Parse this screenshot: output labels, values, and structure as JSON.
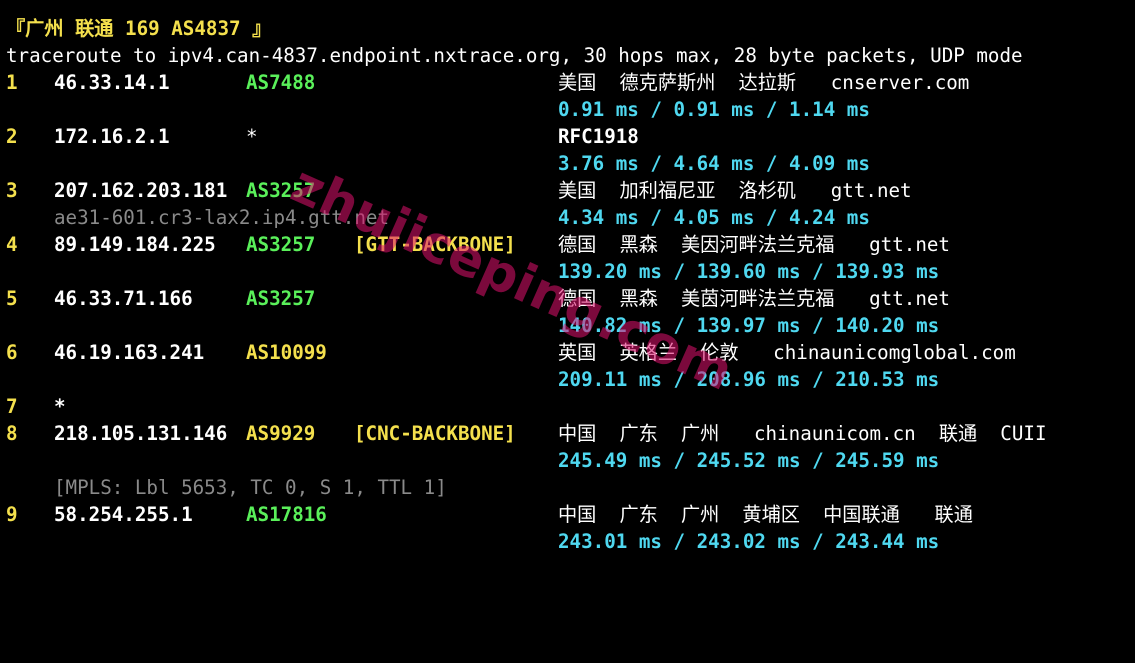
{
  "header": "『广州 联通 169 AS4837 』",
  "trace_cmd": "traceroute to ipv4.can-4837.endpoint.nxtrace.org, 30 hops max, 28 byte packets, UDP mode",
  "hops": [
    {
      "n": "1",
      "ip": "46.33.14.1",
      "asn": "AS7488",
      "tag": "",
      "geo": "美国  德克萨斯州  达拉斯   cnserver.com",
      "rtt": "0.91 ms / 0.91 ms / 1.14 ms"
    },
    {
      "n": "2",
      "ip": "172.16.2.1",
      "asn": "*",
      "tag": "",
      "geo": "RFC1918",
      "rtt": "3.76 ms / 4.64 ms / 4.09 ms"
    },
    {
      "n": "3",
      "ip": "207.162.203.181",
      "asn": "AS3257",
      "tag": "",
      "geo": "美国  加利福尼亚  洛杉矶   gtt.net",
      "rtt": "4.34 ms / 4.05 ms / 4.24 ms",
      "rdns": "ae31-601.cr3-lax2.ip4.gtt.net"
    },
    {
      "n": "4",
      "ip": "89.149.184.225",
      "asn": "AS3257",
      "tag": "[GTT-BACKBONE]",
      "geo": "德国  黑森  美因河畔法兰克福   gtt.net",
      "rtt": "139.20 ms / 139.60 ms / 139.93 ms"
    },
    {
      "n": "5",
      "ip": "46.33.71.166",
      "asn": "AS3257",
      "tag": "",
      "geo": "德国  黑森  美茵河畔法兰克福   gtt.net",
      "rtt": "140.82 ms / 139.97 ms / 140.20 ms"
    },
    {
      "n": "6",
      "ip": "46.19.163.241",
      "asn": "AS10099",
      "tag": "",
      "geo": "英国  英格兰  伦敦   chinaunicomglobal.com",
      "rtt": "209.11 ms / 208.96 ms / 210.53 ms"
    },
    {
      "n": "7",
      "ip": "*"
    },
    {
      "n": "8",
      "ip": "218.105.131.146",
      "asn": "AS9929",
      "tag": "[CNC-BACKBONE]",
      "geo": "中国  广东  广州   chinaunicom.cn  联通  CUII",
      "rtt": "245.49 ms / 245.52 ms / 245.59 ms",
      "mpls": "[MPLS: Lbl 5653, TC 0, S 1, TTL 1]"
    },
    {
      "n": "9",
      "ip": "58.254.255.1",
      "asn": "AS17816",
      "tag": "",
      "geo": "中国  广东  广州  黄埔区  中国联通   联通",
      "rtt": "243.01 ms / 243.02 ms / 243.44 ms"
    }
  ],
  "watermark": "zhujiceping.com",
  "colors": {
    "background": "#000000",
    "hop_number": "#f4e04d",
    "asn_green": "#5af05a",
    "asn_yellow": "#f4e04d",
    "rtt": "#4fd8f0",
    "dim": "#8a8a8a",
    "watermark": "#e0126e"
  }
}
